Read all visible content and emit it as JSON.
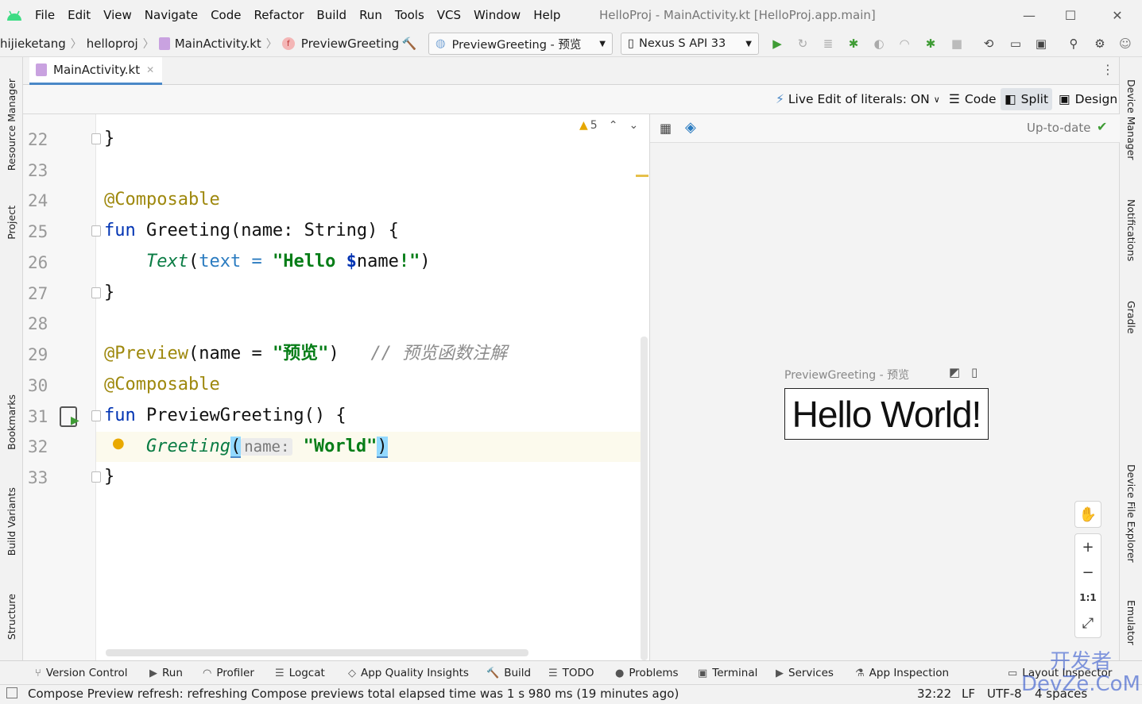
{
  "window": {
    "title": "HelloProj - MainActivity.kt [HelloProj.app.main]",
    "minimize": "—",
    "maximize": "☐",
    "close": "✕"
  },
  "menu": [
    "File",
    "Edit",
    "View",
    "Navigate",
    "Code",
    "Refactor",
    "Build",
    "Run",
    "Tools",
    "VCS",
    "Window",
    "Help"
  ],
  "breadcrumbs": [
    "hijieketang",
    "helloproj",
    "MainActivity.kt",
    "PreviewGreeting"
  ],
  "run_config": "PreviewGreeting - 预览",
  "device": "Nexus S API 33",
  "editor_tab": "MainActivity.kt",
  "split_toolbar": {
    "live_edit": "Live Edit of literals: ON",
    "code": "Code",
    "split": "Split",
    "design": "Design"
  },
  "inspections": {
    "warnings": "5"
  },
  "code_lines": [
    {
      "no": "22"
    },
    {
      "no": "23"
    },
    {
      "no": "24"
    },
    {
      "no": "25"
    },
    {
      "no": "26"
    },
    {
      "no": "27"
    },
    {
      "no": "28"
    },
    {
      "no": "29"
    },
    {
      "no": "30"
    },
    {
      "no": "31"
    },
    {
      "no": "32"
    },
    {
      "no": "33"
    }
  ],
  "code": {
    "l22": "}",
    "l24": "@Composable",
    "l25_kw": "fun",
    "l25_rest": " Greeting(name: String) {",
    "l26_fn": "Text",
    "l26_p1": "(",
    "l26_param": "text",
    "l26_eq": " = ",
    "l26_str1": "\"Hello ",
    "l26_dollar": "$",
    "l26_var": "name",
    "l26_str2": "!\"",
    "l26_close": ")",
    "l27": "}",
    "l29_ann": "@Preview",
    "l29_mid": "(name = ",
    "l29_str": "\"预览\"",
    "l29_close": ")",
    "l29_cmt": "// 预览函数注解",
    "l30": "@Composable",
    "l31_kw": "fun",
    "l31_rest": " PreviewGreeting() {",
    "l32_fn": "Greeting",
    "l32_open": "(",
    "l32_hint": "name:",
    "l32_str": "\"World\"",
    "l32_close": ")",
    "l33": "}"
  },
  "preview": {
    "status": "Up-to-date",
    "label": "PreviewGreeting - 预览",
    "rendered_text": "Hello World!",
    "zoom_in": "+",
    "zoom_out": "−",
    "zoom_actual": "1:1"
  },
  "left_tools": [
    "Resource Manager",
    "Project",
    "Bookmarks",
    "Build Variants",
    "Structure"
  ],
  "right_tools": [
    "Device Manager",
    "Notifications",
    "Gradle",
    "Device File Explorer",
    "Emulator"
  ],
  "bottom_tools": [
    "Version Control",
    "Run",
    "Profiler",
    "Logcat",
    "App Quality Insights",
    "Build",
    "TODO",
    "Problems",
    "Terminal",
    "Services",
    "App Inspection",
    "Layout Inspector"
  ],
  "status": {
    "message": "Compose Preview refresh: refreshing Compose previews total elapsed time was 1 s 980 ms (19 minutes ago)",
    "position": "32:22",
    "line_sep": "LF",
    "encoding": "UTF-8",
    "indent": "4 spaces"
  },
  "watermark": "开发者 DevZe.CoM",
  "colors": {
    "keyword": "#0033b3",
    "annotation": "#9e880d",
    "string": "#067d17",
    "accent": "#4a88c7",
    "run_green": "#3f9c35"
  }
}
